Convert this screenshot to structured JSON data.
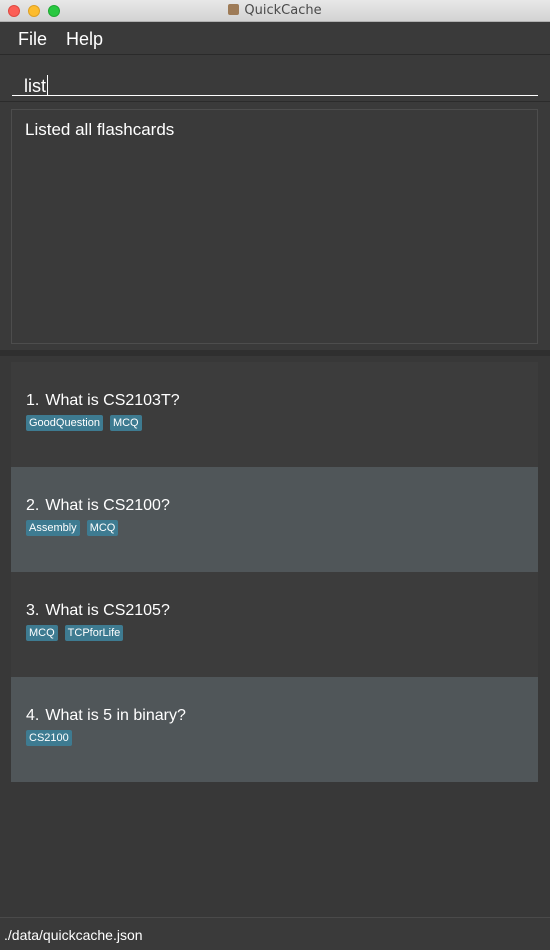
{
  "window": {
    "title": "QuickCache"
  },
  "menu": {
    "file": "File",
    "help": "Help"
  },
  "command": {
    "value": "list"
  },
  "result": {
    "message": "Listed all flashcards"
  },
  "flashcards": [
    {
      "index": "1.",
      "question": "What is CS2103T?",
      "tags": [
        "GoodQuestion",
        "MCQ"
      ]
    },
    {
      "index": "2.",
      "question": "What is CS2100?",
      "tags": [
        "Assembly",
        "MCQ"
      ]
    },
    {
      "index": "3.",
      "question": "What is CS2105?",
      "tags": [
        "MCQ",
        "TCPforLife"
      ]
    },
    {
      "index": "4.",
      "question": "What is 5 in binary?",
      "tags": [
        "CS2100"
      ]
    }
  ],
  "status": {
    "path": "./data/quickcache.json"
  },
  "colors": {
    "tag": "#3e7b91",
    "card_alt": "#505659",
    "background": "#3a3a3a"
  }
}
